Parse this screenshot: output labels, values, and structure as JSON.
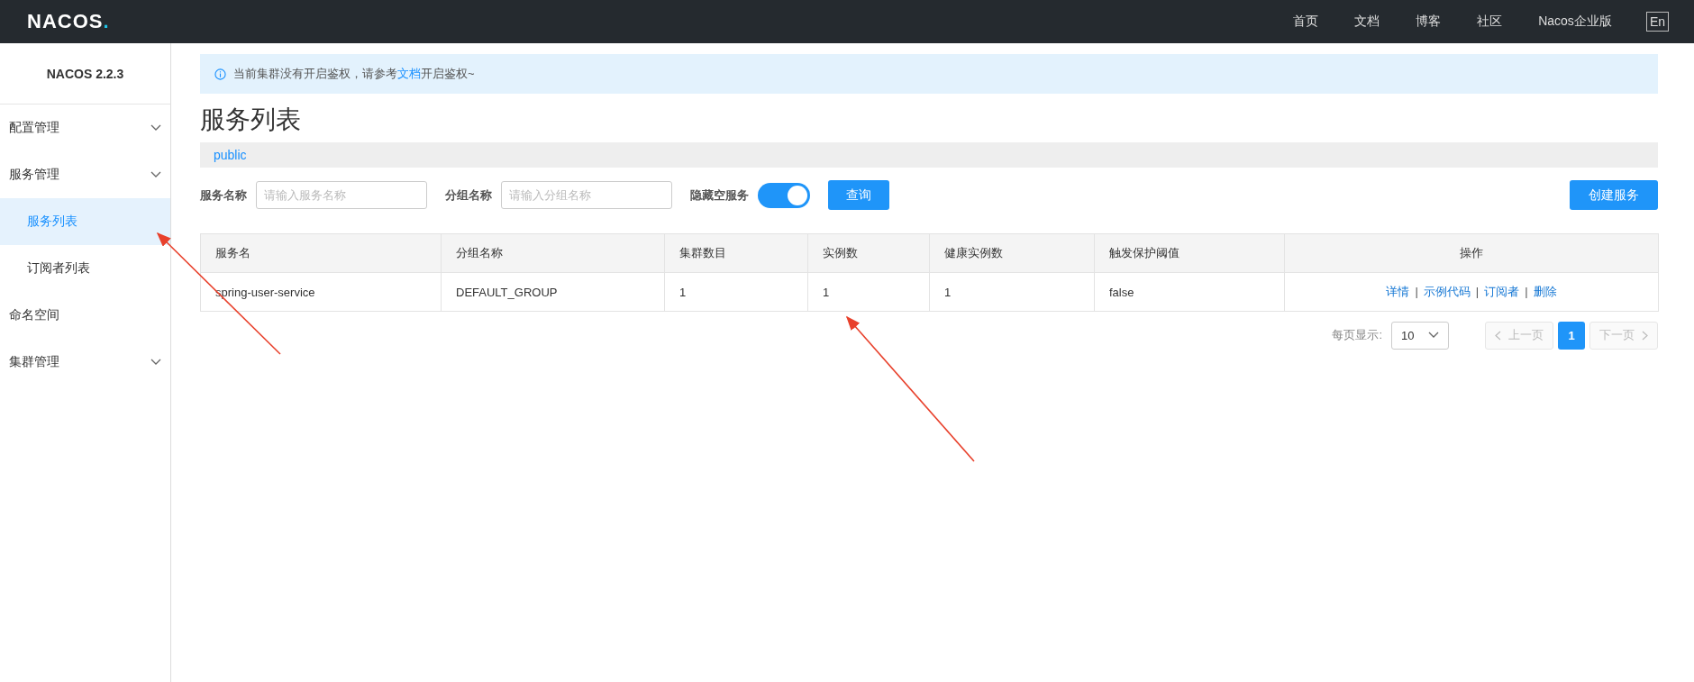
{
  "top_nav": {
    "logo": "NACOS",
    "logo_dot": ".",
    "links": [
      "首页",
      "文档",
      "博客",
      "社区",
      "Nacos企业版"
    ],
    "language": {
      "label": "En",
      "kind": "button"
    }
  },
  "sidebar": {
    "version": "NACOS 2.2.3",
    "items": [
      {
        "label": "配置管理",
        "kind": "group",
        "selected": false
      },
      {
        "label": "服务管理",
        "kind": "group",
        "selected": false,
        "children": [
          {
            "label": "服务列表",
            "selected": true
          },
          {
            "label": "订阅者列表",
            "selected": false
          }
        ]
      },
      {
        "label": "命名空间",
        "kind": "link",
        "selected": false
      },
      {
        "label": "集群管理",
        "kind": "group",
        "selected": false
      }
    ]
  },
  "notice": {
    "text": "当前集群没有开启鉴权，请参考",
    "link": "文档",
    "text_after": "开启鉴权~"
  },
  "page_title": "服务列表",
  "namespaces": [
    {
      "label": "public",
      "selected": true
    }
  ],
  "filters": [
    {
      "label": "服务名称",
      "placeholder": "请输入服务名称"
    },
    {
      "label": "分组名称",
      "placeholder": "请输入分组名称"
    }
  ],
  "hide_empty": {
    "label": "隐藏空服务",
    "on": true
  },
  "query_button": "查询",
  "create_button": "创建服务",
  "table": {
    "columns": [
      "服务名",
      "分组名称",
      "集群数目",
      "实例数",
      "健康实例数",
      "触发保护阈值",
      "操作"
    ],
    "rows": [
      {
        "cells": [
          "spring-user-service",
          "DEFAULT_GROUP",
          "1",
          "1",
          "1",
          "false"
        ],
        "actions": [
          "详情",
          "示例代码",
          "订阅者",
          "删除"
        ],
        "action_separators": [
          "|",
          "|",
          "|"
        ]
      }
    ]
  },
  "pagination": {
    "page_size_label": "每页显示:",
    "page_size": "10",
    "prev": {
      "label": "上一页",
      "disabled": true
    },
    "pages": [
      {
        "label": "1",
        "selected": true
      }
    ],
    "next": {
      "label": "下一页",
      "disabled": true
    }
  }
}
